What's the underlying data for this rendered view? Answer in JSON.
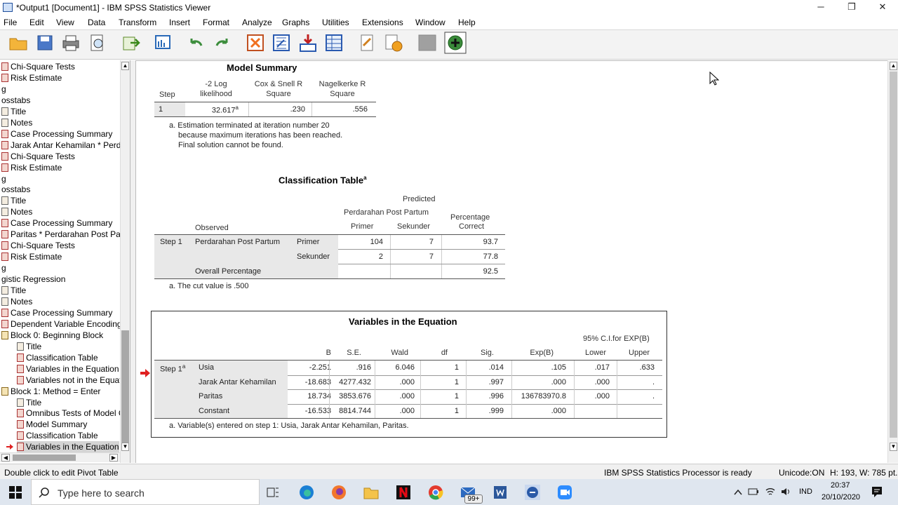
{
  "window": {
    "title": "*Output1 [Document1] - IBM SPSS Statistics Viewer",
    "minimize": "─",
    "restore": "❐",
    "close": "✕"
  },
  "menu": [
    "File",
    "Edit",
    "View",
    "Data",
    "Transform",
    "Insert",
    "Format",
    "Analyze",
    "Graphs",
    "Utilities",
    "Extensions",
    "Window",
    "Help"
  ],
  "outline": [
    {
      "label": "Chi-Square Tests",
      "icon": "red-table-icon"
    },
    {
      "label": "Risk Estimate",
      "icon": "red-table-icon"
    },
    {
      "label": "g",
      "icon": ""
    },
    {
      "label": "osstabs",
      "icon": ""
    },
    {
      "label": "Title",
      "icon": "title-icon"
    },
    {
      "label": "Notes",
      "icon": "notes-icon"
    },
    {
      "label": "Case Processing Summary",
      "icon": "red-table-icon"
    },
    {
      "label": "Jarak Antar Kehamilan * Perda",
      "icon": "red-table-icon"
    },
    {
      "label": "Chi-Square Tests",
      "icon": "red-table-icon"
    },
    {
      "label": "Risk Estimate",
      "icon": "red-table-icon"
    },
    {
      "label": "g",
      "icon": ""
    },
    {
      "label": "osstabs",
      "icon": ""
    },
    {
      "label": "Title",
      "icon": "title-icon"
    },
    {
      "label": "Notes",
      "icon": "notes-icon"
    },
    {
      "label": "Case Processing Summary",
      "icon": "red-table-icon"
    },
    {
      "label": "Paritas * Perdarahan Post Par",
      "icon": "red-table-icon"
    },
    {
      "label": "Chi-Square Tests",
      "icon": "red-table-icon"
    },
    {
      "label": "Risk Estimate",
      "icon": "red-table-icon"
    },
    {
      "label": "g",
      "icon": ""
    },
    {
      "label": "gistic Regression",
      "icon": ""
    },
    {
      "label": "Title",
      "icon": "title-icon"
    },
    {
      "label": "Notes",
      "icon": "notes-icon"
    },
    {
      "label": "Case Processing Summary",
      "icon": "red-table-icon"
    },
    {
      "label": "Dependent Variable Encoding",
      "icon": "red-table-icon"
    },
    {
      "label": "Block 0: Beginning Block",
      "icon": "book-icon"
    },
    {
      "label": "Title",
      "icon": "title-icon",
      "indent": 1
    },
    {
      "label": "Classification Table",
      "icon": "red-table-icon",
      "indent": 1
    },
    {
      "label": "Variables in the Equation",
      "icon": "red-table-icon",
      "indent": 1
    },
    {
      "label": "Variables not in the Equat",
      "icon": "red-table-icon",
      "indent": 1
    },
    {
      "label": "Block 1: Method = Enter",
      "icon": "book-icon"
    },
    {
      "label": "Title",
      "icon": "title-icon",
      "indent": 1
    },
    {
      "label": "Omnibus Tests of Model C",
      "icon": "red-table-icon",
      "indent": 1
    },
    {
      "label": "Model Summary",
      "icon": "red-table-icon",
      "indent": 1
    },
    {
      "label": "Classification Table",
      "icon": "red-table-icon",
      "indent": 1
    },
    {
      "label": "Variables in the Equation",
      "icon": "red-table-icon",
      "indent": 1,
      "selected": true
    }
  ],
  "model_summary": {
    "title": "Model Summary",
    "h_step": "Step",
    "h_log1": "-2 Log",
    "h_log2": "likelihood",
    "h_cox1": "Cox & Snell R",
    "h_cox2": "Square",
    "h_nag1": "Nagelkerke R",
    "h_nag2": "Square",
    "row_step": "1",
    "row_log": "32.617",
    "row_log_sup": "a",
    "row_cox": ".230",
    "row_nag": ".556",
    "note1": "a. Estimation terminated at iteration number 20",
    "note2": "because maximum iterations has been reached.",
    "note3": "Final solution cannot be found."
  },
  "classification": {
    "title": "Classification Table",
    "title_sup": "a",
    "predicted": "Predicted",
    "pph": "Perdarahan Post Partum",
    "primer": "Primer",
    "sekunder": "Sekunder",
    "pct1": "Percentage",
    "pct2": "Correct",
    "observed": "Observed",
    "step": "Step 1",
    "var": "Perdarahan Post Partum",
    "r1_label": "Primer",
    "r1_primer": "104",
    "r1_sekunder": "7",
    "r1_pct": "93.7",
    "r2_label": "Sekunder",
    "r2_primer": "2",
    "r2_sekunder": "7",
    "r2_pct": "77.8",
    "overall": "Overall Percentage",
    "overall_pct": "92.5",
    "note": "a. The cut value is .500"
  },
  "variables": {
    "title": "Variables in the Equation",
    "ci": "95% C.I.for EXP(B)",
    "h_b": "B",
    "h_se": "S.E.",
    "h_wald": "Wald",
    "h_df": "df",
    "h_sig": "Sig.",
    "h_exp": "Exp(B)",
    "h_lower": "Lower",
    "h_upper": "Upper",
    "step": "Step 1",
    "step_sup": "a",
    "rows": [
      {
        "name": "Usia",
        "b": "-2.251",
        "se": ".916",
        "wald": "6.046",
        "df": "1",
        "sig": ".014",
        "exp": ".105",
        "lower": ".017",
        "upper": ".633"
      },
      {
        "name": "Jarak Antar Kehamilan",
        "b": "-18.683",
        "se": "4277.432",
        "wald": ".000",
        "df": "1",
        "sig": ".997",
        "exp": ".000",
        "lower": ".000",
        "upper": "."
      },
      {
        "name": "Paritas",
        "b": "18.734",
        "se": "3853.676",
        "wald": ".000",
        "df": "1",
        "sig": ".996",
        "exp": "136783970.8",
        "lower": ".000",
        "upper": "."
      },
      {
        "name": "Constant",
        "b": "-16.533",
        "se": "8814.744",
        "wald": ".000",
        "df": "1",
        "sig": ".999",
        "exp": ".000",
        "lower": "",
        "upper": ""
      }
    ],
    "note": "a. Variable(s) entered on step 1: Usia, Jarak Antar Kehamilan, Paritas."
  },
  "status": {
    "left": "Double click to edit Pivot Table",
    "processor": "IBM SPSS Statistics Processor is ready",
    "unicode": "Unicode:ON",
    "size": "H: 193, W: 785 pt."
  },
  "taskbar": {
    "search": "Type here to search",
    "lang": "IND",
    "time": "20:37",
    "date": "20/10/2020",
    "badge": "99+"
  }
}
